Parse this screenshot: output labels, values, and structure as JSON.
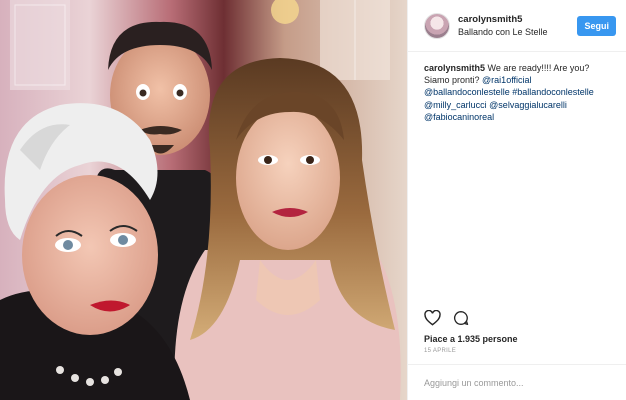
{
  "post": {
    "username": "carolynsmith5",
    "location": "Ballando con Le Stelle",
    "follow_label": "Segui"
  },
  "caption": {
    "username": "carolynsmith5",
    "text": "We are ready!!!! Are you? Siamo pronti?",
    "tags": [
      "@rai1official",
      "@ballandoconlestelle",
      "#ballandoconlestelle",
      "@milly_carlucci",
      "@selvaggialucarelli",
      "@fabiocaninoreal"
    ]
  },
  "actions": {
    "like_icon": "heart-icon",
    "comment_icon": "comment-icon"
  },
  "likes": "Piace a 1.935 persone",
  "date": "15 APRILE",
  "comment_box": {
    "placeholder": "Aggiungi un commento..."
  },
  "photo": {
    "description_icon": "post-photo"
  }
}
